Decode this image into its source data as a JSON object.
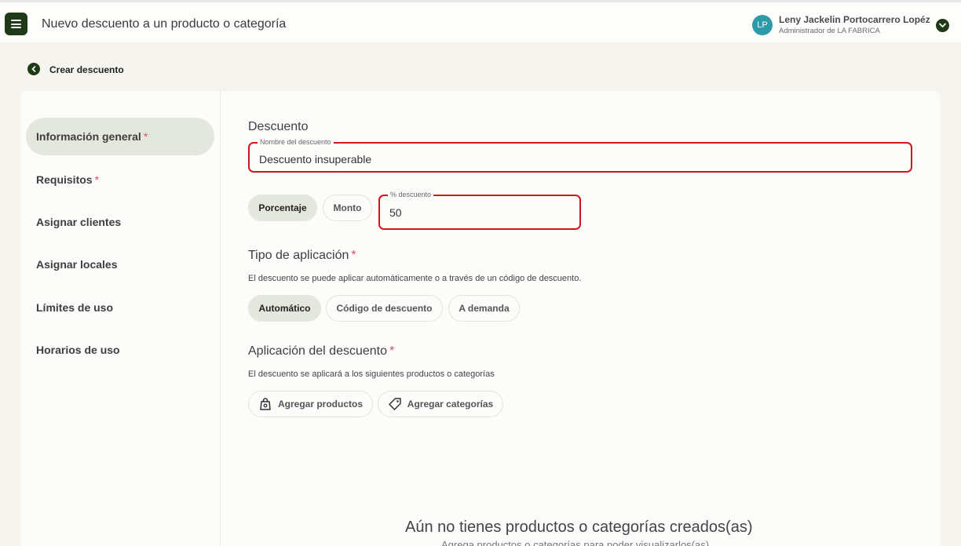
{
  "header": {
    "title": "Nuevo descuento a un producto o categoría",
    "user": {
      "initials": "LP",
      "name": "Leny Jackelin Portocarrero Lopéz",
      "role": "Administrador de LA FABRICA"
    }
  },
  "breadcrumb": {
    "back_label": "Crear descuento"
  },
  "sidebar": {
    "items": [
      {
        "label": "Información general",
        "required": "*"
      },
      {
        "label": "Requisitos",
        "required": "*"
      },
      {
        "label": "Asignar clientes"
      },
      {
        "label": "Asignar locales"
      },
      {
        "label": "Límites de uso"
      },
      {
        "label": "Horarios de uso"
      }
    ]
  },
  "form": {
    "section_title": "Descuento",
    "name_field": {
      "label": "Nombre del descuento",
      "value": "Descuento insuperable"
    },
    "type_toggle": {
      "options": [
        "Porcentaje",
        "Monto"
      ],
      "selected": "Porcentaje"
    },
    "percent_field": {
      "label": "% descuento",
      "value": "50"
    },
    "application_type": {
      "title": "Tipo de aplicación",
      "required": "*",
      "description": "El descuento se puede aplicar automáticamente o a través de un código de descuento.",
      "options": [
        "Automático",
        "Código de descuento",
        "A demanda"
      ],
      "selected": "Automático"
    },
    "discount_application": {
      "title": "Aplicación del descuento",
      "required": "*",
      "description": "El descuento se aplicará a los siguientes productos o categorías",
      "add_products": "Agregar productos",
      "add_categories": "Agregar categorías"
    },
    "empty_state": {
      "title": "Aún no tienes productos o categorías creados(as)",
      "subtitle": "Agrega productos o categorías para poder visualizarlos(as)"
    }
  },
  "colors": {
    "brand_dark": "#1f3a16",
    "selected_bg": "#e4e7dd",
    "error_border": "#d4141c",
    "required": "#e0506a",
    "avatar": "#2d9aa8"
  }
}
